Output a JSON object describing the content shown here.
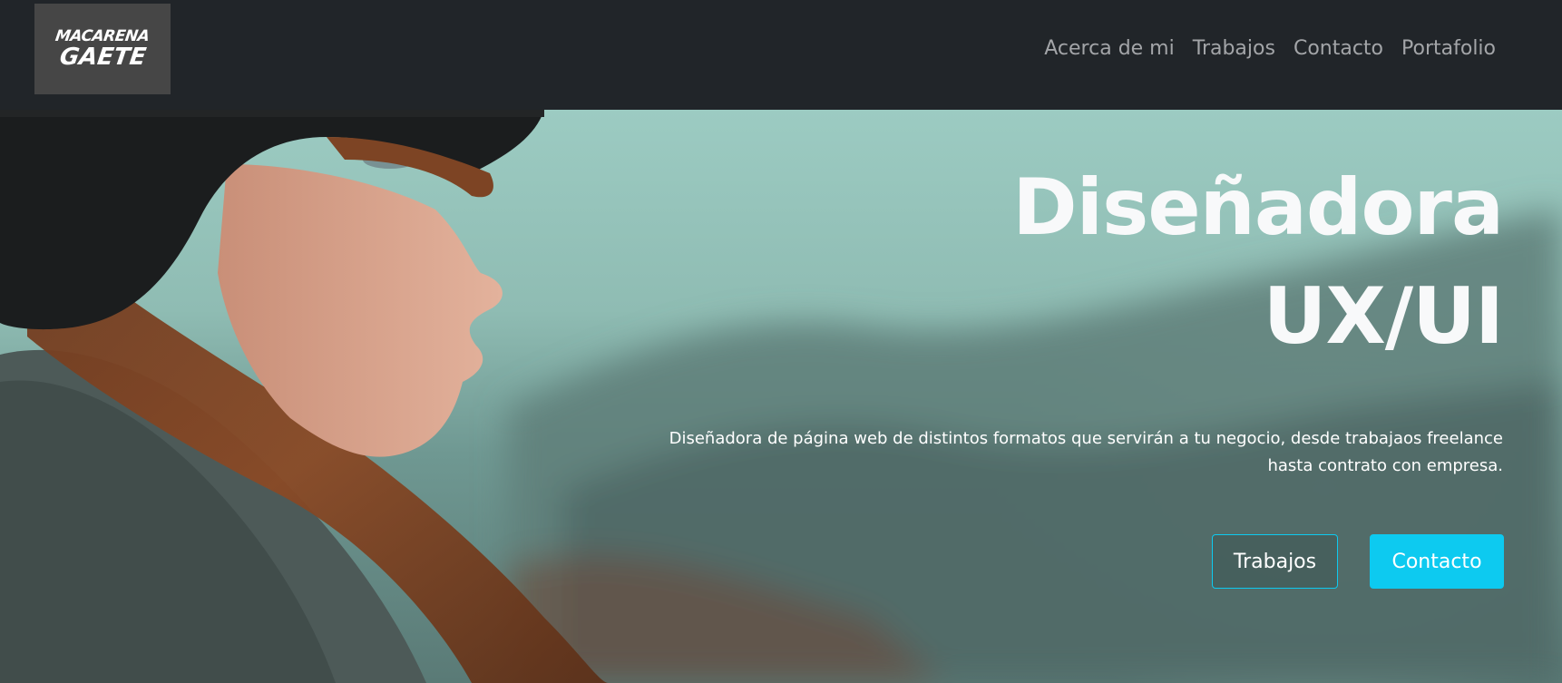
{
  "brand": {
    "line1": "MACARENA",
    "line2": "GAETE"
  },
  "nav": {
    "items": [
      "Acerca de mi",
      "Trabajos",
      "Contacto",
      "Portafolio"
    ]
  },
  "hero": {
    "title_line1": "Diseñadora",
    "title_line2": "UX/UI",
    "description_line1": "Diseñadora de página web de distintos formatos que servirán a tu negocio, desde trabajaos freelance",
    "description_line2": "hasta contrato con empresa.",
    "button_outline": "Trabajos",
    "button_solid": "Contacto"
  },
  "colors": {
    "navbar_bg": "#212529",
    "nav_link": "#a3a5a8",
    "accent": "#0dcaf0",
    "logo_bg": "#464646",
    "hero_text": "#f8f9fa"
  }
}
